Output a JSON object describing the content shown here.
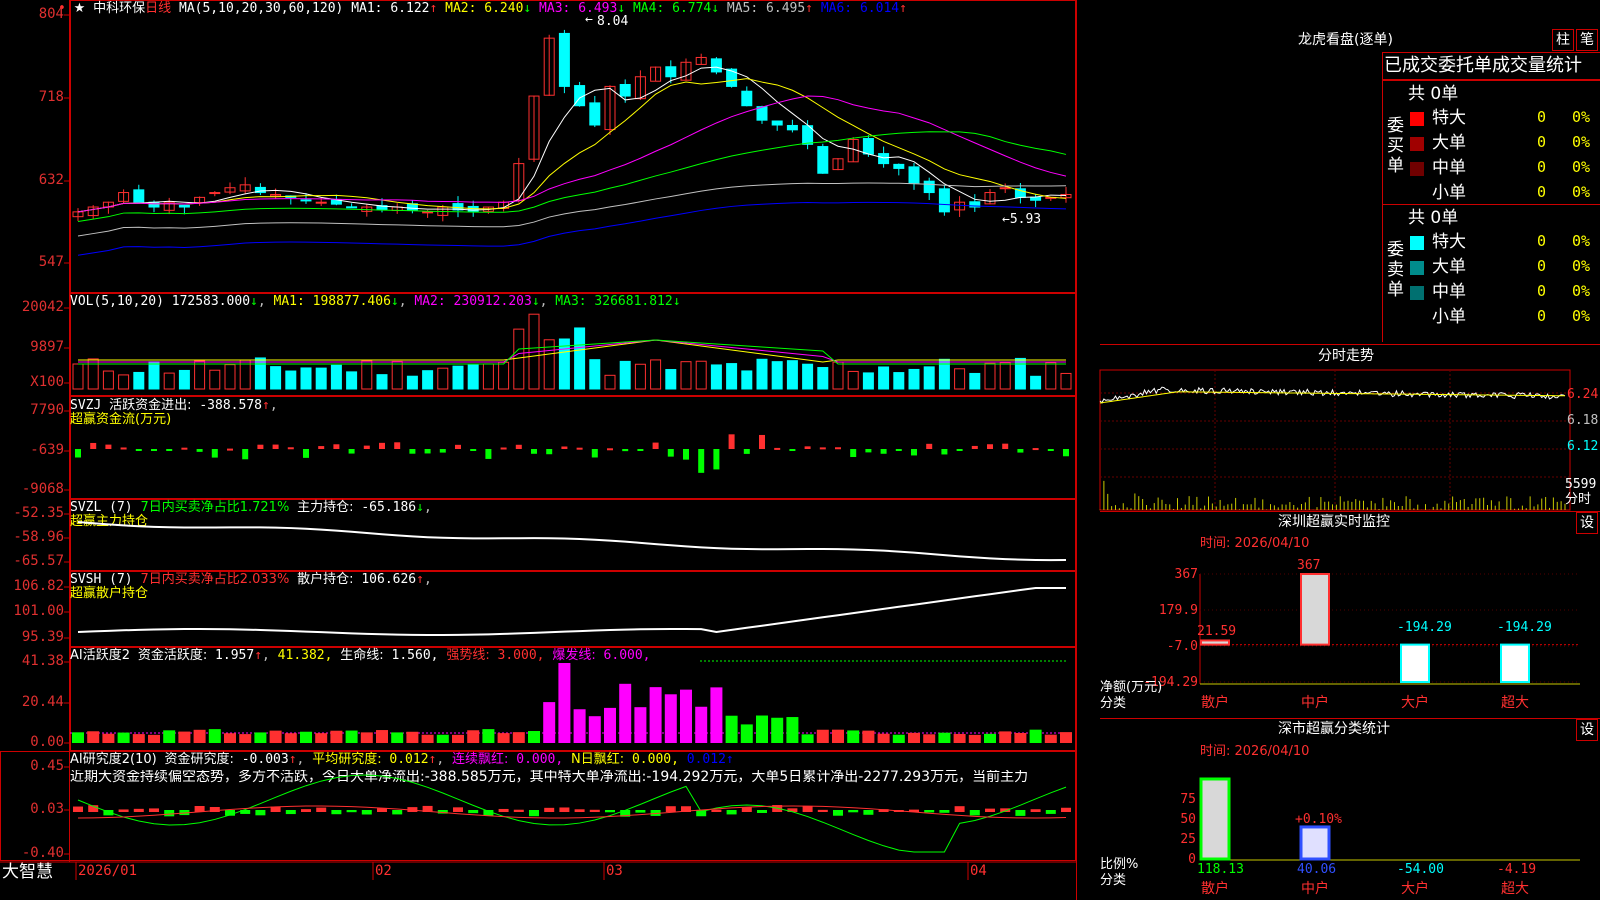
{
  "stock": {
    "name": "中科环保",
    "period": "日线",
    "star": "★"
  },
  "main": {
    "ma_label": "MA(5,10,20,30,60,120)",
    "ma": [
      {
        "label": "MA1:",
        "value": "6.122",
        "arrow": "↑",
        "color": "#ffffff"
      },
      {
        "label": "MA2:",
        "value": "6.240",
        "arrow": "↓",
        "color": "#ffff00"
      },
      {
        "label": "MA3:",
        "value": "6.493",
        "arrow": "↓",
        "color": "#ff00ff"
      },
      {
        "label": "MA4:",
        "value": "6.774",
        "arrow": "↓",
        "color": "#00ff00"
      },
      {
        "label": "MA5:",
        "value": "6.495",
        "arrow": "↑",
        "color": "#c0c0c0"
      },
      {
        "label": "MA6:",
        "value": "6.014",
        "arrow": "↑",
        "color": "#0000ff"
      }
    ],
    "yticks": [
      "804",
      "718",
      "632",
      "547"
    ],
    "high_mark": "8.04",
    "low_mark": "5.93"
  },
  "vol": {
    "label": "VOL(5,10,20)",
    "value": "172583.000",
    "ma1": "MA1: 198877.406",
    "ma2": "MA2: 230912.203",
    "ma3": "MA3: 326681.812",
    "yticks": [
      "20042",
      "9897",
      "X100"
    ]
  },
  "svzj": {
    "label": "SVZJ",
    "title": "活跃资金进出:",
    "value": "-388.578",
    "sub": "超赢资金流(万元)",
    "yticks": [
      "7790",
      "-639",
      "-9068"
    ]
  },
  "svzl": {
    "label": "SVZL (7)",
    "desc": "7日内买卖净占比1.721%",
    "hold": "主力持仓:",
    "value": "-65.186",
    "sub": "超赢主力持仓",
    "yticks": [
      "-52.35",
      "-58.96",
      "-65.57"
    ]
  },
  "svsh": {
    "label": "SVSH (7)",
    "desc": "7日内买卖净占比2.033%",
    "hold": "散户持仓:",
    "value": "106.626",
    "sub": "超赢散户持仓",
    "yticks": [
      "106.82",
      "101.00",
      "95.39"
    ]
  },
  "ai1": {
    "label": "AI活跃度2",
    "t1": "资金活跃度:",
    "v1": "1.957",
    "v2": "41.382,",
    "t3": "生命线:",
    "v3": "1.560,",
    "t4": "强势线:",
    "v4": "3.000,",
    "t5": "爆发线:",
    "v5": "6.000,",
    "yticks": [
      "41.38",
      "20.44",
      "0.00"
    ]
  },
  "ai2": {
    "label": "AI研究度2(10)",
    "t1": "资金研究度:",
    "v1": "-0.003",
    "t2": "平均研究度:",
    "v2": "0.012",
    "t3": "连续飘红:",
    "v3": "0.000,",
    "t4": "N日飘红:",
    "v4": "0.000,",
    "v5": "0.012",
    "summary": "近期大资金持续偏空态势，多方不活跃，今日大单净流出:-388.585万元，其中特大单净流出:-194.292万元，大单5日累计净出-2277.293万元，当前主力",
    "yticks": [
      "0.45",
      "0.03",
      "-0.40"
    ]
  },
  "xaxis": {
    "brand": "大智慧",
    "labels": [
      "2026/01",
      "02",
      "03",
      "04"
    ]
  },
  "right": {
    "lh_title": "龙虎看盘(逐单)",
    "btn1": "柱",
    "btn2": "笔",
    "stat_title": "已成交委托单成交量统计",
    "buy": {
      "side": "委买单",
      "total": "共 0单",
      "rows": [
        {
          "name": "特大",
          "count": "0",
          "pct": "0%",
          "color": "#ff0000"
        },
        {
          "name": "大单",
          "count": "0",
          "pct": "0%",
          "color": "#a00000"
        },
        {
          "name": "中单",
          "count": "0",
          "pct": "0%",
          "color": "#700000"
        },
        {
          "name": "小单",
          "count": "0",
          "pct": "0%",
          "color": ""
        }
      ]
    },
    "sell": {
      "side": "委卖单",
      "total": "共 0单",
      "rows": [
        {
          "name": "特大",
          "count": "0",
          "pct": "0%",
          "color": "#00ffff"
        },
        {
          "name": "大单",
          "count": "0",
          "pct": "0%",
          "color": "#008c8c"
        },
        {
          "name": "中单",
          "count": "0",
          "pct": "0%",
          "color": "#007070"
        },
        {
          "name": "小单",
          "count": "0",
          "pct": "0%",
          "color": ""
        }
      ]
    },
    "ft_title": "分时走势",
    "ft_yticks": [
      "6.24",
      "6.18",
      "6.12"
    ],
    "ft_vol": "5599",
    "ft_vol_unit": "分时",
    "sz_title": "深圳超赢实时监控",
    "set": "设",
    "time_label": "时间: 2026/04/10",
    "sz_yticks": [
      "367",
      "179.9",
      "-7.0",
      "-194.29"
    ],
    "sz_ylab1": "净额(万元)",
    "sz_ylab2": "分类",
    "sz_bars": [
      {
        "cat": "散户",
        "value": 21.59,
        "label": "21.59"
      },
      {
        "cat": "中户",
        "value": 367,
        "label": "367"
      },
      {
        "cat": "大户",
        "value": -194.29,
        "label": "-194.29"
      },
      {
        "cat": "超大",
        "value": -194.29,
        "label": "-194.29"
      }
    ],
    "cls_title": "深市超赢分类统计",
    "cls_yticks": [
      "75",
      "50",
      "25",
      "0"
    ],
    "cls_ylab1": "比例%",
    "cls_ylab2": "分类",
    "cls_bars": [
      {
        "cat": "散户",
        "value": 118.13,
        "label": "118.13"
      },
      {
        "cat": "中户",
        "value": 40.06,
        "label": "40.06",
        "note": "+0.10%"
      },
      {
        "cat": "大户",
        "value": -54.0,
        "label": "-54.00"
      },
      {
        "cat": "超大",
        "value": -4.19,
        "label": "-4.19"
      }
    ]
  },
  "chart_data": {
    "type": "bar",
    "title": "深圳超赢实时监控",
    "xlabel": "分类",
    "ylabel": "净额(万元)",
    "categories": [
      "散户",
      "中户",
      "大户",
      "超大"
    ],
    "values": [
      21.59,
      367,
      -194.29,
      -194.29
    ],
    "ylim": [
      -194.29,
      367
    ]
  }
}
